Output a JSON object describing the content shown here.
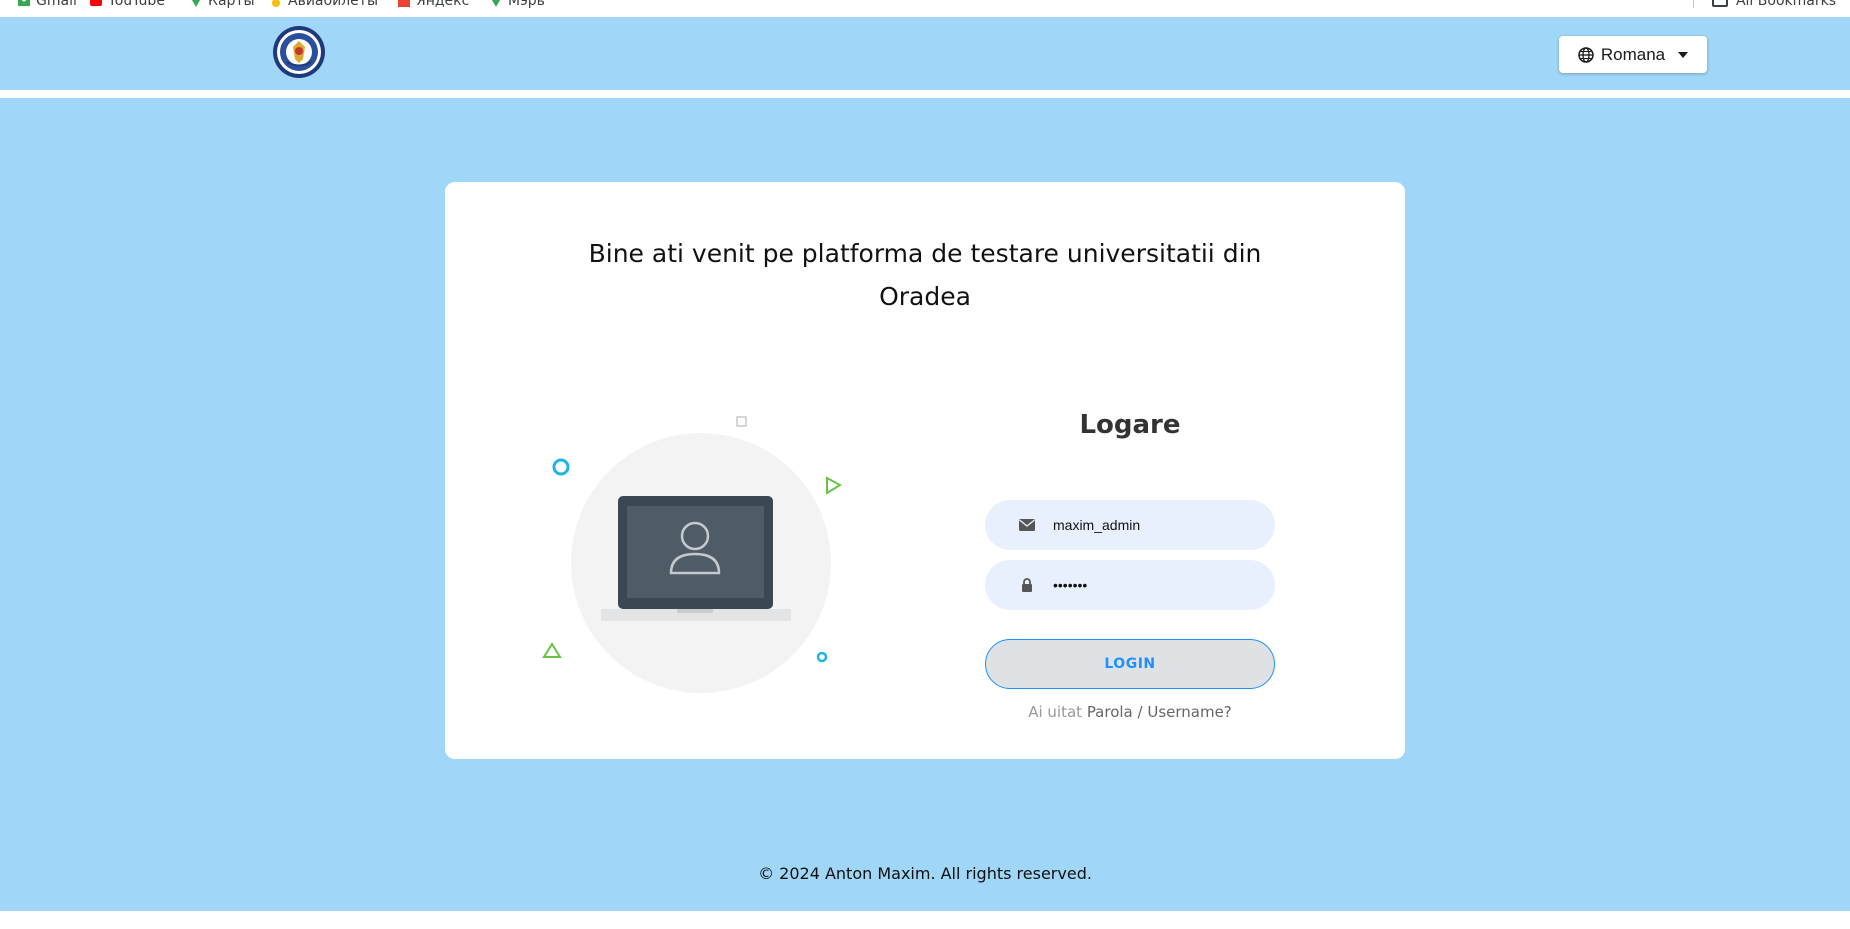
{
  "bookmarks": {
    "items": [
      {
        "label": "Gmail",
        "icon": "gmail-icon",
        "color": "#34a853"
      },
      {
        "label": "YouTube",
        "icon": "youtube-icon",
        "color": "#ff0000"
      },
      {
        "label": "Карты",
        "icon": "maps-pin-icon",
        "color": "#34a853"
      },
      {
        "label": "Авиабилеты",
        "icon": "flights-icon",
        "color": "#fbbc04"
      },
      {
        "label": "Яндекс",
        "icon": "yandex-icon",
        "color": "#ea4335"
      },
      {
        "label": "Мэрь",
        "icon": "maps-pin-icon",
        "color": "#34a853"
      }
    ],
    "all_bookmarks": "All Bookmarks"
  },
  "header": {
    "logo_icon": "university-seal-icon",
    "language": {
      "icon": "globe-icon",
      "selected": "Romana"
    }
  },
  "card": {
    "welcome": "Bine ati venit pe platforma de testare universitatii din Oradea",
    "illustration_icon": "laptop-user-icon",
    "login": {
      "title": "Logare",
      "username": {
        "icon": "envelope-icon",
        "value": "maxim_admin"
      },
      "password": {
        "icon": "lock-icon",
        "value": "1234567"
      },
      "button": "LOGIN",
      "forgot": {
        "prefix": "Ai uitat",
        "link": "Parola / Username?"
      }
    }
  },
  "footer": {
    "text": "© 2024 Anton Maxim. All rights reserved."
  },
  "colors": {
    "background": "#a0d6f7",
    "accent": "#1e90ff",
    "field": "#e8f0fe"
  }
}
